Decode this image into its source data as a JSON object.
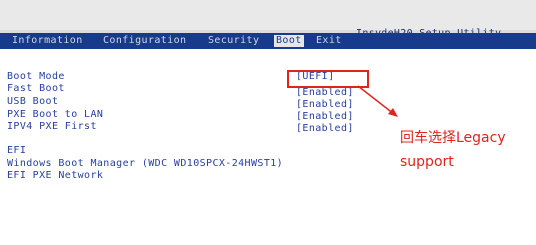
{
  "window": {
    "title": "InsydeH20 Setup Utility"
  },
  "tabs": [
    {
      "label": "Information",
      "active": false
    },
    {
      "label": "Configuration",
      "active": false
    },
    {
      "label": "Security",
      "active": false
    },
    {
      "label": "Boot",
      "active": true
    },
    {
      "label": "Exit",
      "active": false
    }
  ],
  "settings": [
    {
      "label": "Boot Mode",
      "value": "[UEFI]"
    },
    {
      "label": "Fast Boot",
      "value": "[Enabled]"
    },
    {
      "label": "USB Boot",
      "value": "[Enabled]"
    },
    {
      "label": "PXE Boot to LAN",
      "value": "[Enabled]"
    },
    {
      "label": "IPV4 PXE First",
      "value": "[Enabled]"
    }
  ],
  "boot_list": {
    "header": "EFI",
    "items": [
      "Windows Boot Manager (WDC WD10SPCX-24HWST1)",
      "EFI PXE Network"
    ]
  },
  "annotation": {
    "line1": "回车选择Legacy",
    "line2": "support",
    "color": "#e0241b"
  },
  "colors": {
    "tab_bar": "#173a8a",
    "text_blue": "#2740a0",
    "panel": "#ffffff"
  }
}
